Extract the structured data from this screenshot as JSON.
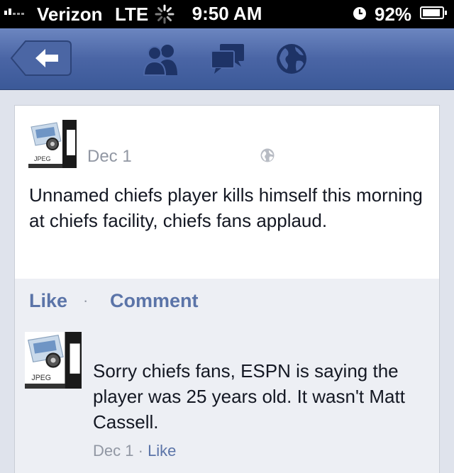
{
  "status_bar": {
    "carrier": "Verizon",
    "network": "LTE",
    "time": "9:50 AM",
    "battery": "92%",
    "battery_level": 0.92
  },
  "nav_bar": {
    "icons": [
      "back-arrow-icon",
      "friend-requests-icon",
      "messages-icon",
      "notifications-globe-icon"
    ],
    "colors": {
      "bar": "#3b5998",
      "icon": "#1e3366"
    }
  },
  "post": {
    "avatar_text": "JPEG",
    "date": "Dec 1",
    "text": "Unnamed chiefs player kills himself this morning at chiefs facility, chiefs fans applaud."
  },
  "actions": {
    "like": "Like",
    "separator": "·",
    "comment": "Comment"
  },
  "comment": {
    "avatar_text": "JPEG",
    "text": "Sorry chiefs fans, ESPN is saying the player was 25 years old. It wasn't Matt Cassell.",
    "date": "Dec 1",
    "separator": "·",
    "like": "Like"
  }
}
